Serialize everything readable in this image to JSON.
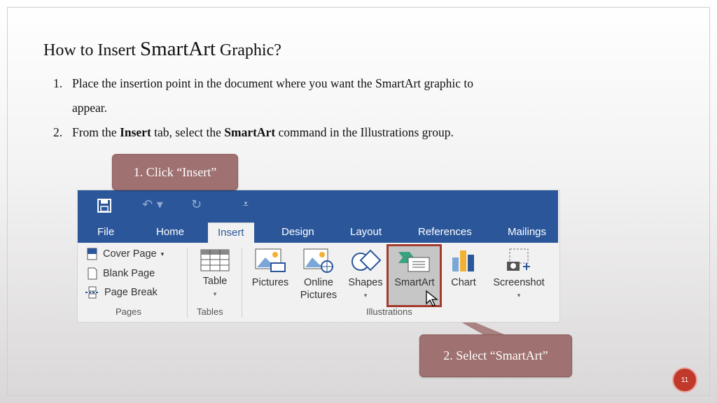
{
  "slide": {
    "title_pre": "How to Insert",
    "title_big": "SmartArt",
    "title_post": "Graphic?",
    "steps": [
      {
        "num": "1.",
        "line1": "Place the insertion point in the document where you want the SmartArt graphic to",
        "line2": "appear."
      },
      {
        "num": "2.",
        "part1": "From the",
        "bold1": "Insert",
        "part2": "tab, select the",
        "bold2": "SmartArt",
        "part3": "command in the Illustrations group."
      }
    ],
    "callout1": "1. Click “Insert”",
    "callout2": "2. Select “SmartArt”",
    "page_number": "11"
  },
  "ribbon": {
    "tabs": [
      "File",
      "Home",
      "Insert",
      "Design",
      "Layout",
      "References",
      "Mailings"
    ],
    "active_tab": "Insert",
    "pages": {
      "cover": "Cover Page",
      "blank": "Blank Page",
      "break": "Page Break",
      "label": "Pages"
    },
    "tables": {
      "table": "Table",
      "label": "Tables"
    },
    "illustrations": {
      "pictures": "Pictures",
      "online_line1": "Online",
      "online_line2": "Pictures",
      "shapes": "Shapes",
      "smartart": "SmartArt",
      "chart": "Chart",
      "screenshot": "Screenshot",
      "label": "Illustrations"
    }
  },
  "colors": {
    "word_blue": "#2b579a",
    "callout": "#9f7170",
    "highlight": "#a23b2d"
  }
}
